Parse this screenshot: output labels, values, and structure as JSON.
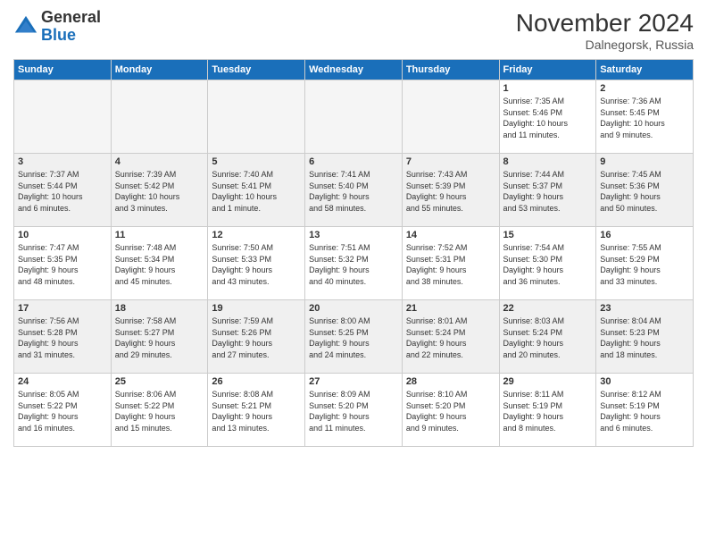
{
  "header": {
    "logo_general": "General",
    "logo_blue": "Blue",
    "month_title": "November 2024",
    "location": "Dalnegorsk, Russia"
  },
  "days_of_week": [
    "Sunday",
    "Monday",
    "Tuesday",
    "Wednesday",
    "Thursday",
    "Friday",
    "Saturday"
  ],
  "weeks": [
    [
      {
        "day": "",
        "info": "",
        "empty": true
      },
      {
        "day": "",
        "info": "",
        "empty": true
      },
      {
        "day": "",
        "info": "",
        "empty": true
      },
      {
        "day": "",
        "info": "",
        "empty": true
      },
      {
        "day": "",
        "info": "",
        "empty": true
      },
      {
        "day": "1",
        "info": "Sunrise: 7:35 AM\nSunset: 5:46 PM\nDaylight: 10 hours\nand 11 minutes.",
        "empty": false
      },
      {
        "day": "2",
        "info": "Sunrise: 7:36 AM\nSunset: 5:45 PM\nDaylight: 10 hours\nand 9 minutes.",
        "empty": false
      }
    ],
    [
      {
        "day": "3",
        "info": "Sunrise: 7:37 AM\nSunset: 5:44 PM\nDaylight: 10 hours\nand 6 minutes.",
        "empty": false
      },
      {
        "day": "4",
        "info": "Sunrise: 7:39 AM\nSunset: 5:42 PM\nDaylight: 10 hours\nand 3 minutes.",
        "empty": false
      },
      {
        "day": "5",
        "info": "Sunrise: 7:40 AM\nSunset: 5:41 PM\nDaylight: 10 hours\nand 1 minute.",
        "empty": false
      },
      {
        "day": "6",
        "info": "Sunrise: 7:41 AM\nSunset: 5:40 PM\nDaylight: 9 hours\nand 58 minutes.",
        "empty": false
      },
      {
        "day": "7",
        "info": "Sunrise: 7:43 AM\nSunset: 5:39 PM\nDaylight: 9 hours\nand 55 minutes.",
        "empty": false
      },
      {
        "day": "8",
        "info": "Sunrise: 7:44 AM\nSunset: 5:37 PM\nDaylight: 9 hours\nand 53 minutes.",
        "empty": false
      },
      {
        "day": "9",
        "info": "Sunrise: 7:45 AM\nSunset: 5:36 PM\nDaylight: 9 hours\nand 50 minutes.",
        "empty": false
      }
    ],
    [
      {
        "day": "10",
        "info": "Sunrise: 7:47 AM\nSunset: 5:35 PM\nDaylight: 9 hours\nand 48 minutes.",
        "empty": false
      },
      {
        "day": "11",
        "info": "Sunrise: 7:48 AM\nSunset: 5:34 PM\nDaylight: 9 hours\nand 45 minutes.",
        "empty": false
      },
      {
        "day": "12",
        "info": "Sunrise: 7:50 AM\nSunset: 5:33 PM\nDaylight: 9 hours\nand 43 minutes.",
        "empty": false
      },
      {
        "day": "13",
        "info": "Sunrise: 7:51 AM\nSunset: 5:32 PM\nDaylight: 9 hours\nand 40 minutes.",
        "empty": false
      },
      {
        "day": "14",
        "info": "Sunrise: 7:52 AM\nSunset: 5:31 PM\nDaylight: 9 hours\nand 38 minutes.",
        "empty": false
      },
      {
        "day": "15",
        "info": "Sunrise: 7:54 AM\nSunset: 5:30 PM\nDaylight: 9 hours\nand 36 minutes.",
        "empty": false
      },
      {
        "day": "16",
        "info": "Sunrise: 7:55 AM\nSunset: 5:29 PM\nDaylight: 9 hours\nand 33 minutes.",
        "empty": false
      }
    ],
    [
      {
        "day": "17",
        "info": "Sunrise: 7:56 AM\nSunset: 5:28 PM\nDaylight: 9 hours\nand 31 minutes.",
        "empty": false
      },
      {
        "day": "18",
        "info": "Sunrise: 7:58 AM\nSunset: 5:27 PM\nDaylight: 9 hours\nand 29 minutes.",
        "empty": false
      },
      {
        "day": "19",
        "info": "Sunrise: 7:59 AM\nSunset: 5:26 PM\nDaylight: 9 hours\nand 27 minutes.",
        "empty": false
      },
      {
        "day": "20",
        "info": "Sunrise: 8:00 AM\nSunset: 5:25 PM\nDaylight: 9 hours\nand 24 minutes.",
        "empty": false
      },
      {
        "day": "21",
        "info": "Sunrise: 8:01 AM\nSunset: 5:24 PM\nDaylight: 9 hours\nand 22 minutes.",
        "empty": false
      },
      {
        "day": "22",
        "info": "Sunrise: 8:03 AM\nSunset: 5:24 PM\nDaylight: 9 hours\nand 20 minutes.",
        "empty": false
      },
      {
        "day": "23",
        "info": "Sunrise: 8:04 AM\nSunset: 5:23 PM\nDaylight: 9 hours\nand 18 minutes.",
        "empty": false
      }
    ],
    [
      {
        "day": "24",
        "info": "Sunrise: 8:05 AM\nSunset: 5:22 PM\nDaylight: 9 hours\nand 16 minutes.",
        "empty": false
      },
      {
        "day": "25",
        "info": "Sunrise: 8:06 AM\nSunset: 5:22 PM\nDaylight: 9 hours\nand 15 minutes.",
        "empty": false
      },
      {
        "day": "26",
        "info": "Sunrise: 8:08 AM\nSunset: 5:21 PM\nDaylight: 9 hours\nand 13 minutes.",
        "empty": false
      },
      {
        "day": "27",
        "info": "Sunrise: 8:09 AM\nSunset: 5:20 PM\nDaylight: 9 hours\nand 11 minutes.",
        "empty": false
      },
      {
        "day": "28",
        "info": "Sunrise: 8:10 AM\nSunset: 5:20 PM\nDaylight: 9 hours\nand 9 minutes.",
        "empty": false
      },
      {
        "day": "29",
        "info": "Sunrise: 8:11 AM\nSunset: 5:19 PM\nDaylight: 9 hours\nand 8 minutes.",
        "empty": false
      },
      {
        "day": "30",
        "info": "Sunrise: 8:12 AM\nSunset: 5:19 PM\nDaylight: 9 hours\nand 6 minutes.",
        "empty": false
      }
    ]
  ]
}
